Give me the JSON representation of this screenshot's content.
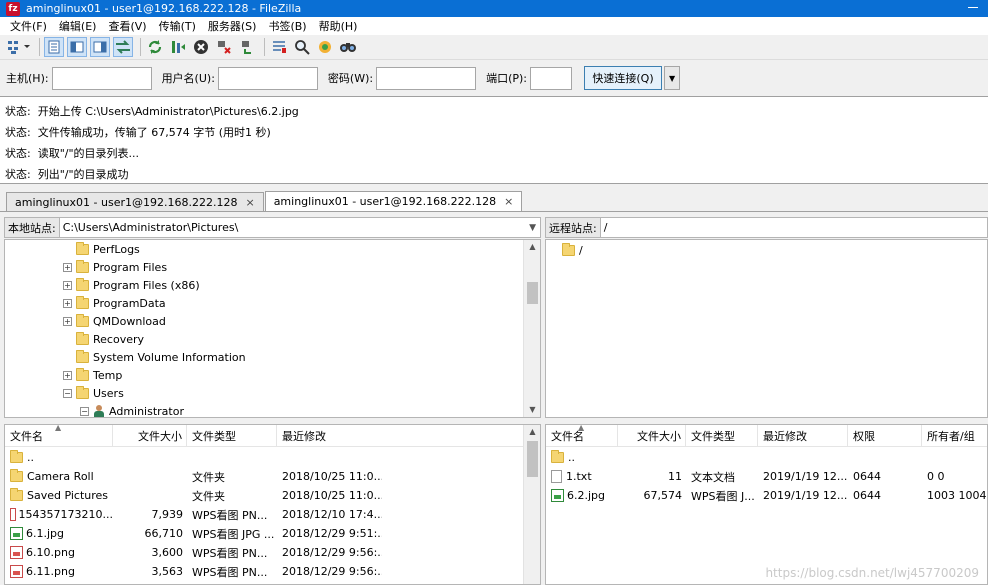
{
  "window": {
    "title": "aminglinux01 - user1@192.168.222.128 - FileZilla",
    "app_icon": "fz"
  },
  "menu": [
    "文件(F)",
    "编辑(E)",
    "查看(V)",
    "传输(T)",
    "服务器(S)",
    "书签(B)",
    "帮助(H)"
  ],
  "quickconnect": {
    "host_label": "主机(H):",
    "host_value": "",
    "user_label": "用户名(U):",
    "user_value": "",
    "pass_label": "密码(W):",
    "pass_value": "",
    "port_label": "端口(P):",
    "port_value": "",
    "connect_label": "快速连接(Q)"
  },
  "log": [
    {
      "k": "状态:",
      "v": "开始上传 C:\\Users\\Administrator\\Pictures\\6.2.jpg"
    },
    {
      "k": "状态:",
      "v": "文件传输成功，传输了 67,574 字节 (用时1 秒)"
    },
    {
      "k": "状态:",
      "v": "读取\"/\"的目录列表..."
    },
    {
      "k": "状态:",
      "v": "列出\"/\"的目录成功"
    }
  ],
  "tabs": [
    {
      "label": "aminglinux01 - user1@192.168.222.128",
      "close": "×"
    },
    {
      "label": "aminglinux01 - user1@192.168.222.128",
      "close": "×"
    }
  ],
  "local": {
    "site_label": "本地站点:",
    "path": "C:\\Users\\Administrator\\Pictures\\",
    "tree": [
      {
        "label": "PerfLogs",
        "exp": ""
      },
      {
        "label": "Program Files",
        "exp": "+"
      },
      {
        "label": "Program Files (x86)",
        "exp": "+"
      },
      {
        "label": "ProgramData",
        "exp": "+"
      },
      {
        "label": "QMDownload",
        "exp": "+"
      },
      {
        "label": "Recovery",
        "exp": ""
      },
      {
        "label": "System Volume Information",
        "exp": ""
      },
      {
        "label": "Temp",
        "exp": "+"
      },
      {
        "label": "Users",
        "exp": "−"
      }
    ],
    "tree_user": {
      "label": "Administrator",
      "exp": "−"
    },
    "columns": [
      "文件名",
      "文件大小",
      "文件类型",
      "最近修改"
    ],
    "files": [
      {
        "name": "..",
        "size": "",
        "type": "",
        "modified": "",
        "icon": "folder"
      },
      {
        "name": "Camera Roll",
        "size": "",
        "type": "文件夹",
        "modified": "2018/10/25 11:0...",
        "icon": "folder"
      },
      {
        "name": "Saved Pictures",
        "size": "",
        "type": "文件夹",
        "modified": "2018/10/25 11:0...",
        "icon": "folder"
      },
      {
        "name": "154357173210...",
        "size": "7,939",
        "type": "WPS看图 PN...",
        "modified": "2018/12/10 17:4...",
        "icon": "img-red"
      },
      {
        "name": "6.1.jpg",
        "size": "66,710",
        "type": "WPS看图 JPG ...",
        "modified": "2018/12/29 9:51:...",
        "icon": "img-green"
      },
      {
        "name": "6.10.png",
        "size": "3,600",
        "type": "WPS看图 PN...",
        "modified": "2018/12/29 9:56:...",
        "icon": "img-red"
      },
      {
        "name": "6.11.png",
        "size": "3,563",
        "type": "WPS看图 PN...",
        "modified": "2018/12/29 9:56:...",
        "icon": "img-red"
      }
    ]
  },
  "remote": {
    "site_label": "远程站点:",
    "path": "/",
    "tree": [
      {
        "label": "/"
      }
    ],
    "columns": [
      "文件名",
      "文件大小",
      "文件类型",
      "最近修改",
      "权限",
      "所有者/组"
    ],
    "files": [
      {
        "name": "..",
        "size": "",
        "type": "",
        "modified": "",
        "perm": "",
        "owner": "",
        "icon": "folder"
      },
      {
        "name": "1.txt",
        "size": "11",
        "type": "文本文档",
        "modified": "2019/1/19 12...",
        "perm": "0644",
        "owner": "0 0",
        "icon": "file"
      },
      {
        "name": "6.2.jpg",
        "size": "67,574",
        "type": "WPS看图 J...",
        "modified": "2019/1/19 12...",
        "perm": "0644",
        "owner": "1003 1004",
        "icon": "img-green"
      }
    ]
  },
  "watermark": "https://blog.csdn.net/lwj457700209"
}
